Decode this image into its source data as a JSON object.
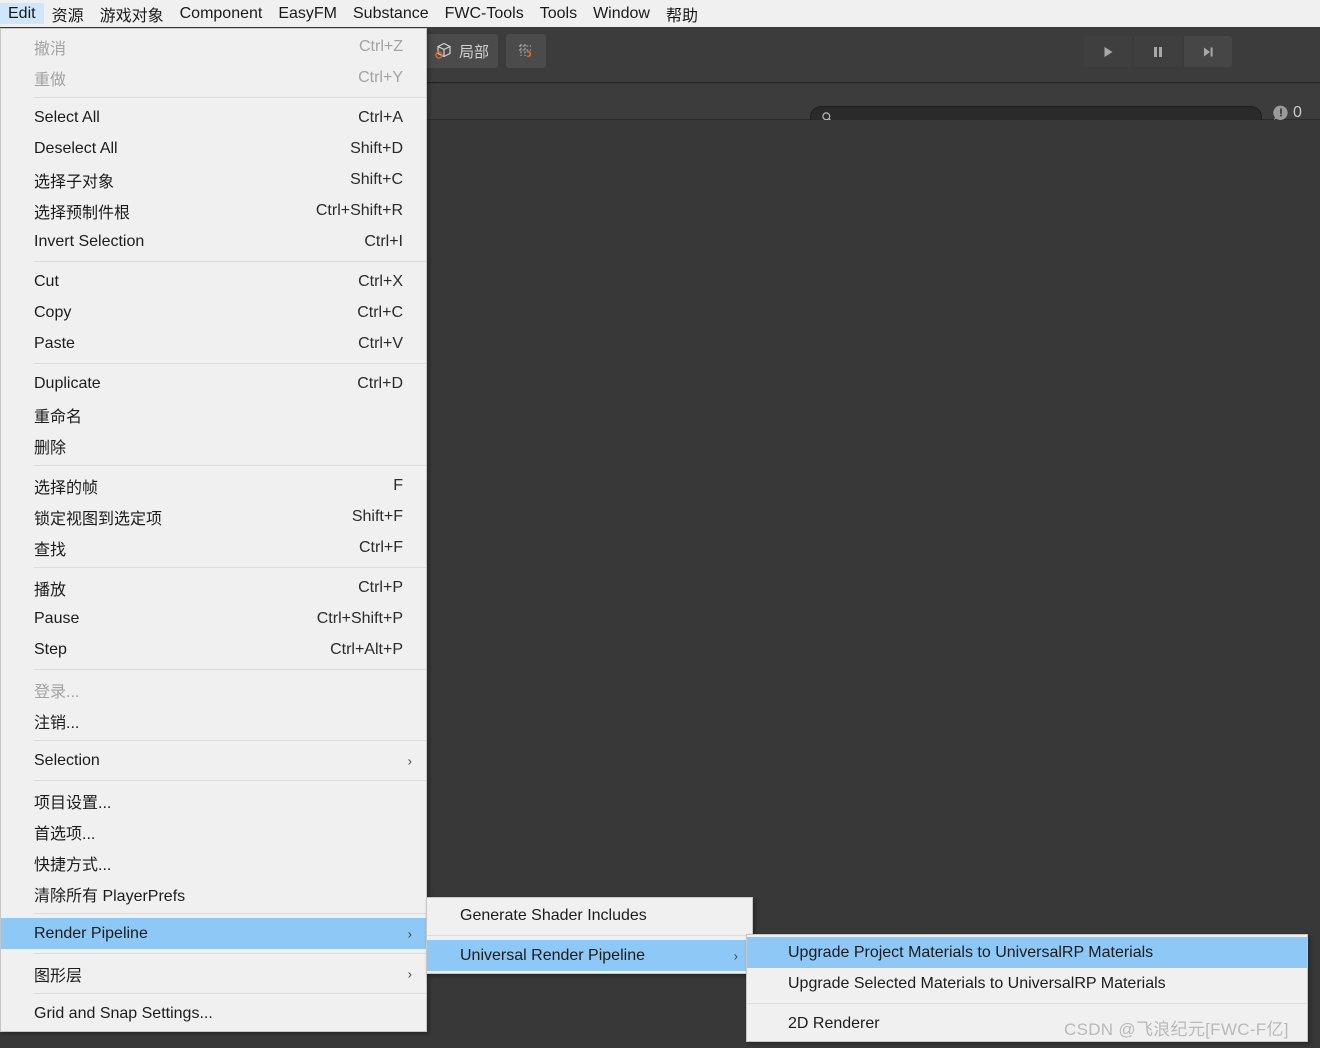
{
  "app": {
    "title": "Unity Editor"
  },
  "menubar": {
    "items": [
      {
        "label": "Edit",
        "active": true
      },
      {
        "label": "资源",
        "active": false
      },
      {
        "label": "游戏对象",
        "active": false
      },
      {
        "label": "Component",
        "active": false
      },
      {
        "label": "EasyFM",
        "active": false
      },
      {
        "label": "Substance",
        "active": false
      },
      {
        "label": "FWC-Tools",
        "active": false
      },
      {
        "label": "Tools",
        "active": false
      },
      {
        "label": "Window",
        "active": false
      },
      {
        "label": "帮助",
        "active": false
      }
    ]
  },
  "toolbar": {
    "pivot_mode_label": "局部",
    "pivot_icon": "pivot-cube-icon",
    "snap_icon": "grid-snap-icon",
    "play_icon": "play-icon",
    "pause_icon": "pause-icon",
    "step_icon": "step-icon"
  },
  "console": {
    "search_placeholder": "",
    "search_value": "",
    "search_icon": "search-icon",
    "error_icon": "error-badge-icon",
    "error_count": "0"
  },
  "edit_menu": {
    "groups": [
      {
        "items": [
          {
            "label": "撤消",
            "shortcut": "Ctrl+Z",
            "disabled": true,
            "submenu": false,
            "highlight": false
          },
          {
            "label": "重做",
            "shortcut": "Ctrl+Y",
            "disabled": true,
            "submenu": false,
            "highlight": false
          }
        ]
      },
      {
        "items": [
          {
            "label": "Select All",
            "shortcut": "Ctrl+A",
            "disabled": false,
            "submenu": false,
            "highlight": false
          },
          {
            "label": "Deselect All",
            "shortcut": "Shift+D",
            "disabled": false,
            "submenu": false,
            "highlight": false
          },
          {
            "label": "选择子对象",
            "shortcut": "Shift+C",
            "disabled": false,
            "submenu": false,
            "highlight": false
          },
          {
            "label": "选择预制件根",
            "shortcut": "Ctrl+Shift+R",
            "disabled": false,
            "submenu": false,
            "highlight": false
          },
          {
            "label": "Invert Selection",
            "shortcut": "Ctrl+I",
            "disabled": false,
            "submenu": false,
            "highlight": false
          }
        ]
      },
      {
        "items": [
          {
            "label": "Cut",
            "shortcut": "Ctrl+X",
            "disabled": false,
            "submenu": false,
            "highlight": false
          },
          {
            "label": "Copy",
            "shortcut": "Ctrl+C",
            "disabled": false,
            "submenu": false,
            "highlight": false
          },
          {
            "label": "Paste",
            "shortcut": "Ctrl+V",
            "disabled": false,
            "submenu": false,
            "highlight": false
          }
        ]
      },
      {
        "items": [
          {
            "label": "Duplicate",
            "shortcut": "Ctrl+D",
            "disabled": false,
            "submenu": false,
            "highlight": false
          },
          {
            "label": "重命名",
            "shortcut": "",
            "disabled": false,
            "submenu": false,
            "highlight": false
          },
          {
            "label": "删除",
            "shortcut": "",
            "disabled": false,
            "submenu": false,
            "highlight": false
          }
        ]
      },
      {
        "items": [
          {
            "label": "选择的帧",
            "shortcut": "F",
            "disabled": false,
            "submenu": false,
            "highlight": false
          },
          {
            "label": "锁定视图到选定项",
            "shortcut": "Shift+F",
            "disabled": false,
            "submenu": false,
            "highlight": false
          },
          {
            "label": "查找",
            "shortcut": "Ctrl+F",
            "disabled": false,
            "submenu": false,
            "highlight": false
          }
        ]
      },
      {
        "items": [
          {
            "label": "播放",
            "shortcut": "Ctrl+P",
            "disabled": false,
            "submenu": false,
            "highlight": false
          },
          {
            "label": "Pause",
            "shortcut": "Ctrl+Shift+P",
            "disabled": false,
            "submenu": false,
            "highlight": false
          },
          {
            "label": "Step",
            "shortcut": "Ctrl+Alt+P",
            "disabled": false,
            "submenu": false,
            "highlight": false
          }
        ]
      },
      {
        "items": [
          {
            "label": "登录...",
            "shortcut": "",
            "disabled": true,
            "submenu": false,
            "highlight": false
          },
          {
            "label": "注销...",
            "shortcut": "",
            "disabled": false,
            "submenu": false,
            "highlight": false
          }
        ]
      },
      {
        "items": [
          {
            "label": "Selection",
            "shortcut": "",
            "disabled": false,
            "submenu": true,
            "highlight": false
          }
        ]
      },
      {
        "items": [
          {
            "label": "项目设置...",
            "shortcut": "",
            "disabled": false,
            "submenu": false,
            "highlight": false
          },
          {
            "label": "首选项...",
            "shortcut": "",
            "disabled": false,
            "submenu": false,
            "highlight": false
          },
          {
            "label": "快捷方式...",
            "shortcut": "",
            "disabled": false,
            "submenu": false,
            "highlight": false
          },
          {
            "label": "清除所有 PlayerPrefs",
            "shortcut": "",
            "disabled": false,
            "submenu": false,
            "highlight": false
          }
        ]
      },
      {
        "items": [
          {
            "label": "Render Pipeline",
            "shortcut": "",
            "disabled": false,
            "submenu": true,
            "highlight": true
          }
        ]
      },
      {
        "items": [
          {
            "label": "图形层",
            "shortcut": "",
            "disabled": false,
            "submenu": true,
            "highlight": false
          }
        ]
      },
      {
        "items": [
          {
            "label": "Grid and Snap Settings...",
            "shortcut": "",
            "disabled": false,
            "submenu": false,
            "highlight": false
          }
        ]
      }
    ]
  },
  "render_pipeline_menu": {
    "groups": [
      {
        "items": [
          {
            "label": "Generate Shader Includes",
            "shortcut": "",
            "disabled": false,
            "submenu": false,
            "highlight": false
          }
        ]
      },
      {
        "items": [
          {
            "label": "Universal Render Pipeline",
            "shortcut": "",
            "disabled": false,
            "submenu": true,
            "highlight": true
          }
        ]
      }
    ]
  },
  "urp_menu": {
    "groups": [
      {
        "items": [
          {
            "label": "Upgrade Project Materials to UniversalRP Materials",
            "shortcut": "",
            "disabled": false,
            "submenu": false,
            "highlight": true
          },
          {
            "label": "Upgrade Selected Materials to UniversalRP Materials",
            "shortcut": "",
            "disabled": false,
            "submenu": false,
            "highlight": false
          }
        ]
      },
      {
        "items": [
          {
            "label": "2D Renderer",
            "shortcut": "",
            "disabled": false,
            "submenu": false,
            "highlight": false
          }
        ]
      }
    ]
  },
  "watermark": {
    "text": "CSDN @飞浪纪元[FWC-F亿]"
  },
  "colors": {
    "menu_bg": "#f0f0f0",
    "menu_highlight": "#8ec8f6",
    "menubar_active": "#cfe7fb",
    "editor_bg": "#383838",
    "toolbar_bg": "#3c3c3c"
  }
}
